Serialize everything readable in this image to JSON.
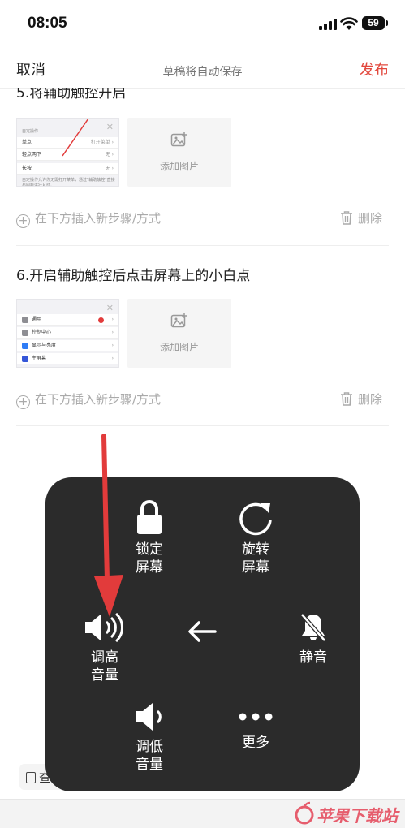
{
  "status": {
    "time": "08:05",
    "battery": "59"
  },
  "nav": {
    "cancel": "取消",
    "title": "草稿将自动保存",
    "publish": "发布"
  },
  "steps": [
    {
      "title": "5.将辅助触控开启",
      "add_image": "添加图片",
      "thumb": {
        "header": "自定操作",
        "rows": [
          {
            "label": "单点",
            "value": "打开菜单 ›"
          },
          {
            "label": "轻点两下",
            "value": "无 ›"
          },
          {
            "label": "长按",
            "value": "无 ›"
          }
        ],
        "caption": "自定操作允许你无需打开菜单，通过\"辅助触控\"直接与图标进行互动。"
      }
    },
    {
      "title": "6.开启辅助触控后点击屏幕上的小白点",
      "add_image": "添加图片",
      "thumb": {
        "rows": [
          {
            "label": "通用",
            "value": "›"
          },
          {
            "label": "控制中心",
            "value": "›"
          },
          {
            "label": "显示与亮度",
            "value": "›"
          },
          {
            "label": "主屏幕",
            "value": "›"
          }
        ]
      }
    }
  ],
  "actions": {
    "insert": "在下方插入新步骤/方式",
    "delete": "删除"
  },
  "assistive_menu": {
    "lock": "锁定\n屏幕",
    "rotate": "旋转\n屏幕",
    "volume_up": "调高\n音量",
    "mute": "静音",
    "volume_down": "调低\n音量",
    "more": "更多"
  },
  "bottom_chip": "查",
  "watermark": "苹果下载站",
  "colors": {
    "accent": "#e2483d",
    "overlay": "#2b2b2b",
    "arrow": "#e23b3b"
  }
}
